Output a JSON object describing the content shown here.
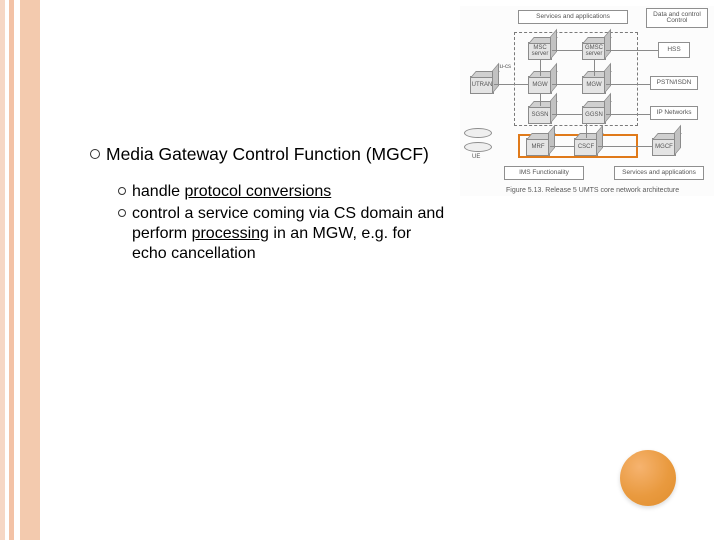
{
  "content": {
    "main_bullet": "Media Gateway Control Function (MGCF)",
    "sub": [
      {
        "pre": "handle ",
        "u": "protocol conversions",
        "post": ""
      },
      {
        "pre": "control a service coming via CS domain and perform ",
        "u": "processing",
        "post": " in an MGW, e.g. for echo cancellation"
      }
    ]
  },
  "diagram": {
    "top_left_box": "Services and applications",
    "top_right_box": "Data and control\nControl",
    "row1": {
      "msc": "MSC\nserver",
      "gmsc": "GMSC\nserver",
      "hss": "HSS"
    },
    "iucs": "Iu-cs",
    "row2": {
      "utran": "UTRAN",
      "mgw1": "MGW",
      "mgw2": "MGW",
      "pstn": "PSTN/ISDN"
    },
    "row3": {
      "sgsn": "SGSN",
      "ggsn": "GGSN",
      "ipn": "IP Networks"
    },
    "row4": {
      "ue": "UE",
      "mrf": "MRF",
      "cscf": "CSCF",
      "mgcf": "MGCF"
    },
    "row5": {
      "ims": "IMS Functionality",
      "svc": "Services and applications"
    },
    "caption": "Figure 5.13. Release 5 UMTS core network architecture"
  }
}
